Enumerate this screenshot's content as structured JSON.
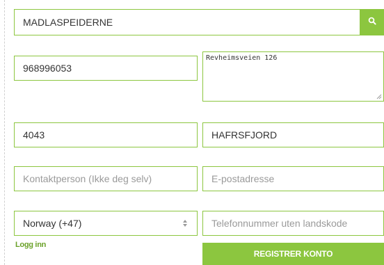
{
  "form": {
    "organization_name": "MADLASPEIDERNE",
    "phone": "968996053",
    "address": "Revheimsveien 126",
    "postal_code": "4043",
    "city": "HAFRSFJORD",
    "contact_person_placeholder": "Kontaktperson (Ikke deg selv)",
    "email_placeholder": "E-postadresse",
    "country_selected": "Norway (+47)",
    "phone_placeholder": "Telefonnummer uten landskode",
    "login_link": "Logg inn",
    "register_button": "REGISTRER KONTO"
  },
  "colors": {
    "accent": "#8cc63f",
    "link": "#6aa128",
    "placeholder": "#9a9a9a"
  },
  "icons": {
    "search": "search-icon",
    "select": "select-arrows-icon",
    "resize": "resize-grip-icon"
  }
}
